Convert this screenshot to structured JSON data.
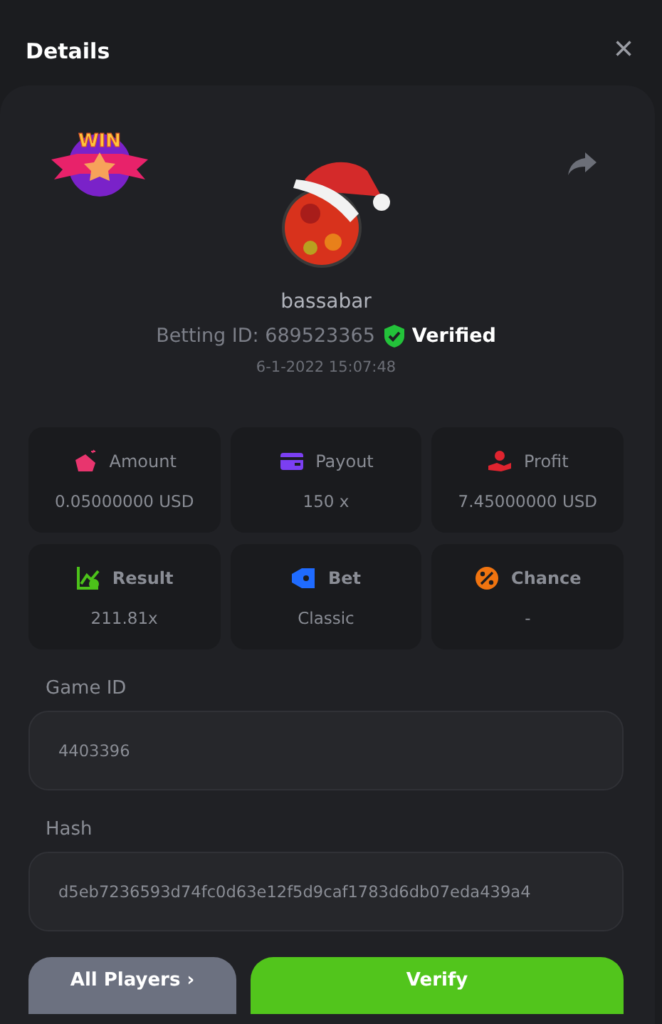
{
  "window": {
    "title": "Details",
    "close": "×"
  },
  "badge": {
    "label": "WIN"
  },
  "player": {
    "name": "bassabar",
    "betting_id": "Betting ID: 689523365",
    "verified": true,
    "verified_label": "Verified",
    "time": "6-1-2022 15:07:48"
  },
  "stats": [
    {
      "kind": "amount",
      "label": "Amount",
      "value": "0.05000000 USD",
      "bold": false,
      "color": "#e8356e"
    },
    {
      "kind": "payout",
      "label": "Payout",
      "value": "150 x",
      "bold": false,
      "color": "#7b3ff2"
    },
    {
      "kind": "profit",
      "label": "Profit",
      "value": "7.45000000 USD",
      "bold": false,
      "color": "#e0242f"
    },
    {
      "kind": "result",
      "label": "Result",
      "value": "211.81x",
      "bold": true,
      "color": "#4cc21a"
    },
    {
      "kind": "bet",
      "label": "Bet",
      "value": "Classic",
      "bold": true,
      "color": "#1f6bff"
    },
    {
      "kind": "chance",
      "label": "Chance",
      "value": "-",
      "bold": true,
      "color": "#f07410"
    }
  ],
  "fields": [
    {
      "label": "Game ID",
      "value": "4403396"
    },
    {
      "label": "Hash",
      "value": "d5eb7236593d74fc0d63e12f5d9caf1783d6db07eda439a4"
    }
  ],
  "buttons": [
    {
      "kind": "secondary",
      "label": "All Players ›"
    },
    {
      "kind": "primary",
      "label": "Verify"
    }
  ]
}
